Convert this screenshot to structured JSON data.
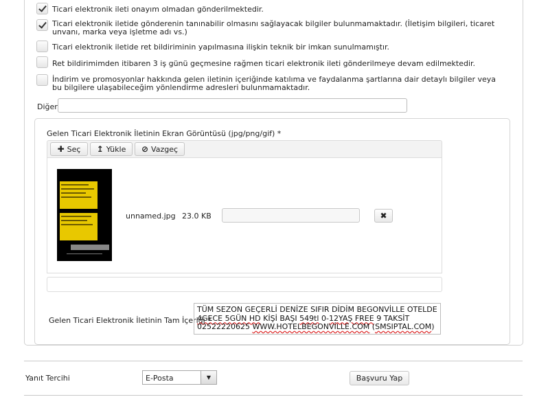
{
  "checkboxes": [
    {
      "label": "Ticari elektronik ileti onayım olmadan gönderilmektedir.",
      "checked": true
    },
    {
      "label": "Ticari elektronik iletide gönderenin tanınabilir olmasını sağlayacak bilgiler bulunmamaktadır. (İletişim bilgileri, ticaret unvanı, marka veya işletme adı vs.)",
      "checked": true
    },
    {
      "label": "Ticari elektronik iletide ret bildiriminin yapılmasına ilişkin teknik bir imkan sunulmamıştır.",
      "checked": false
    },
    {
      "label": "Ret bildirimimden itibaren 3 iş günü geçmesine rağmen ticari elektronik ileti gönderilmeye devam edilmektedir.",
      "checked": false
    },
    {
      "label": "İndirim ve promosyonlar hakkında gelen iletinin içeriğinde katılıma ve faydalanma şartlarına dair detaylı bilgiler veya bu bilgilere ulaşabileceğim yönlendirme adresleri bulunmamaktadır.",
      "checked": false
    }
  ],
  "diger": {
    "label": "Diğer",
    "value": ""
  },
  "upload": {
    "label": "Gelen Ticari Elektronik İletinin Ekran Görüntüsü (jpg/png/gif) *",
    "choose_label": "Seç",
    "upload_label": "Yükle",
    "cancel_label": "Vazgeç",
    "file_name": "unnamed.jpg",
    "file_size": "23.0 KB"
  },
  "content": {
    "label": "Gelen Ticari Elektronik İletinin Tam İçeriği *",
    "t1": "TÜM SEZON GEÇERLİ DENİZE SIFIR DİDİM BEGONVİLLE OTELDE\n",
    "t2": "4GECE 5GÜN HD",
    "t3": " KİŞİ BAŞI ",
    "t4": "549tl",
    "t5": " 0-",
    "t6": "12YAŞ FREE",
    "t7": " 9 TAKSİT\n02522220625 ",
    "t8": "WWW.HOTELBEGONVİLLE.COM",
    "t9": " (",
    "t10": "SMSIPTAL.COM",
    "t11": ")"
  },
  "reply": {
    "label": "Yanıt Tercihi",
    "selected": "E-Posta",
    "submit_label": "Başvuru Yap"
  }
}
